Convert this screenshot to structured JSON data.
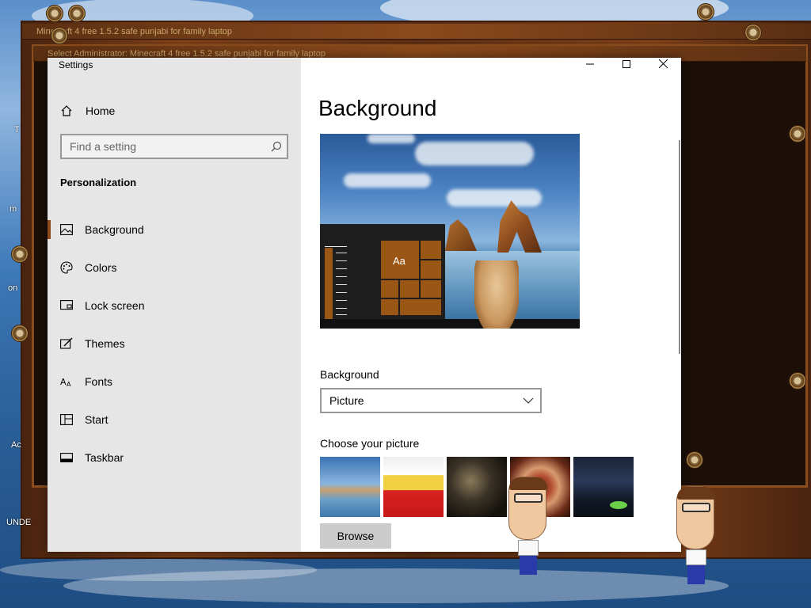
{
  "desktop": {
    "back_window_title": "Select Administrator:  Minecraft 4 free 1.5.2 safe punjabi for family laptop",
    "back_window_title_2": "Minecraft 4 free 1.5.2 safe punjabi for family laptop",
    "labels": [
      "T",
      "m",
      "on",
      "Ac",
      "UNDE"
    ]
  },
  "settings": {
    "app_title": "Settings",
    "controls": {
      "minimize": "minimize",
      "maximize": "maximize",
      "close": "close"
    },
    "sidebar": {
      "home_label": "Home",
      "search_placeholder": "Find a setting",
      "section_title": "Personalization",
      "items": [
        {
          "label": "Background",
          "icon": "picture-icon",
          "active": true
        },
        {
          "label": "Colors",
          "icon": "palette-icon",
          "active": false
        },
        {
          "label": "Lock screen",
          "icon": "lock-screen-icon",
          "active": false
        },
        {
          "label": "Themes",
          "icon": "brush-icon",
          "active": false
        },
        {
          "label": "Fonts",
          "icon": "fonts-icon",
          "active": false
        },
        {
          "label": "Start",
          "icon": "start-icon",
          "active": false
        },
        {
          "label": "Taskbar",
          "icon": "taskbar-icon",
          "active": false
        }
      ]
    },
    "content": {
      "page_title": "Background",
      "preview_tile_text": "Aa",
      "background_label": "Background",
      "background_value": "Picture",
      "choose_label": "Choose your picture",
      "browse_label": "Browse"
    }
  },
  "colors": {
    "accent": "#8a4a1c",
    "sidebar_bg": "#e6e6e6"
  }
}
